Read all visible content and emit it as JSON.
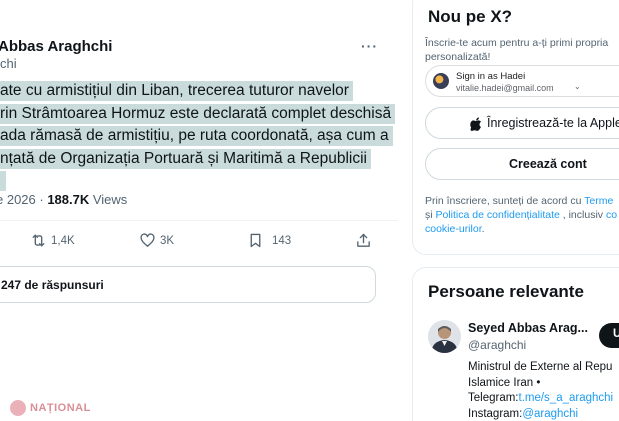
{
  "tweet": {
    "author_name": "Abbas Araghchi",
    "author_handle": "chi",
    "more_label": "···",
    "text_lines": [
      "ate cu armistițiul din Liban, trecerea tuturor navelor",
      "rin Strâmtoarea Hormuz este declarată complet deschisă",
      "ada rămasă de armistițiu, pe ruta coordonată, așa cum a",
      "nțată de Organizația Portuară și Maritimă a Republicii"
    ],
    "date_fragment": "e 2026 · ",
    "views_count": "188.7K",
    "views_label": " Views",
    "actions": {
      "retweet_count": "1,4K",
      "like_count": "3K",
      "bookmark_count": "143"
    },
    "replies_label": "247 de răspunsuri"
  },
  "watermark": "NAȚIONAL",
  "sidebar": {
    "signup_card": {
      "title": "Nou pe X?",
      "description_line1": "Înscrie-te acum pentru a-ți primi propria",
      "description_line2": "personalizată!",
      "google_button": {
        "name": "Sign in as Hadei",
        "email": "vitalie.hadei@gmail.com"
      },
      "apple_button_label": "Înregistrează-te la Apple",
      "create_account_label": "Creează cont",
      "terms": {
        "prefix": "Prin înscriere, sunteți de acord cu ",
        "terms_link": "Terme",
        "and": "și ",
        "privacy_link": "Politica de confidențialitate",
        "middle": " , inclusiv ",
        "cookie_tail": "co",
        "cookie_link": "cookie-urilor",
        "suffix": "."
      }
    },
    "relevant_card": {
      "title": "Persoane relevante",
      "person": {
        "name": "Seyed Abbas Arag...",
        "handle": "@araghchi",
        "follow_label": "U",
        "bio_line1": "Ministrul de Externe al Repu",
        "bio_line2": "Islamice Iran •",
        "telegram_label": "Telegram:",
        "telegram_link": "t.me/s_a_araghchi",
        "instagram_label": "Instagram:",
        "instagram_link": "@araghchi"
      }
    }
  }
}
